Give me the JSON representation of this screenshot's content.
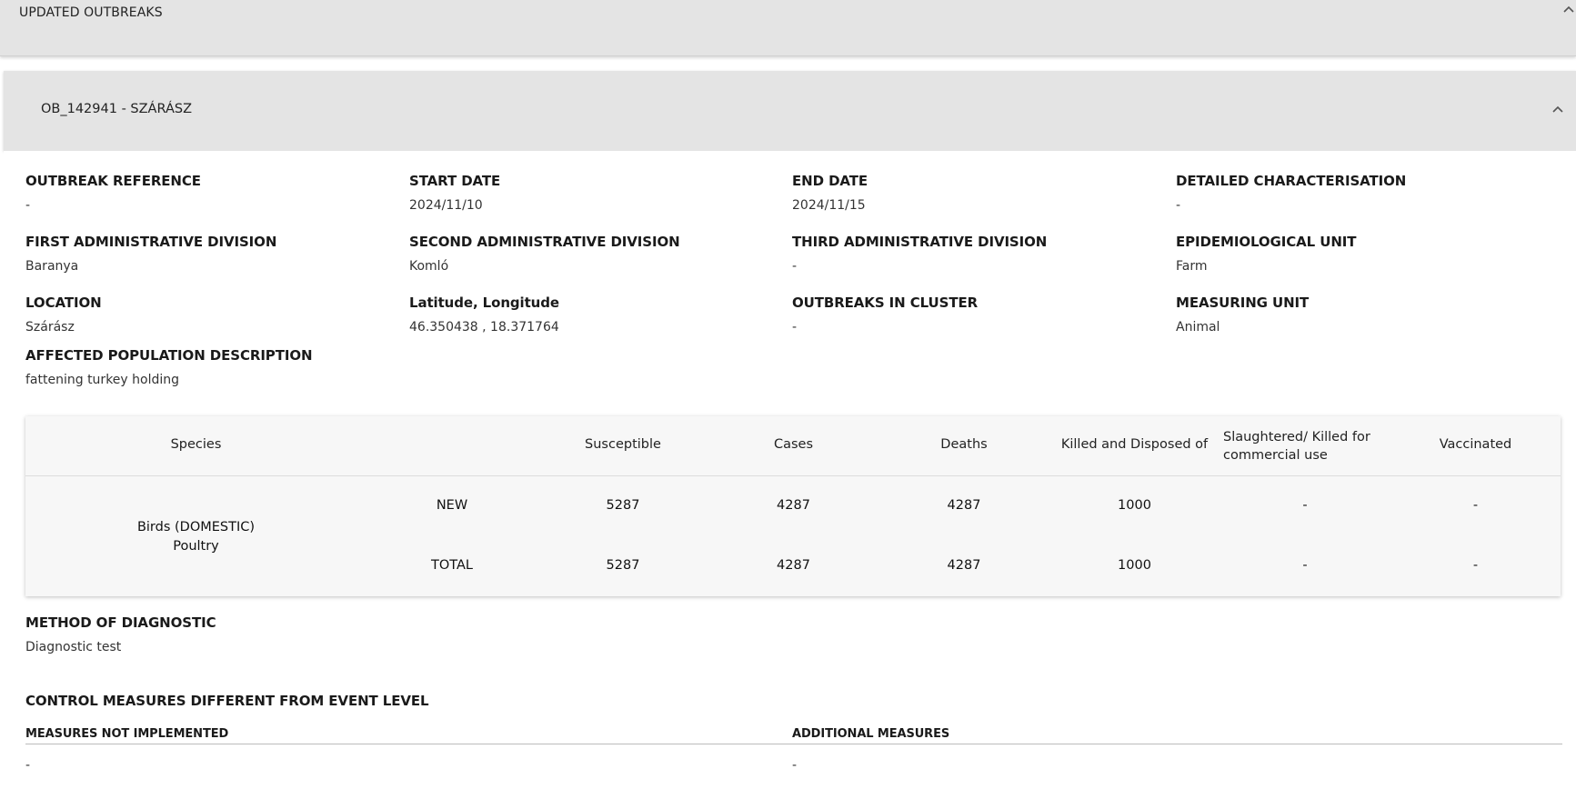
{
  "top_panel": {
    "title": "UPDATED OUTBREAKS"
  },
  "outbreak": {
    "header_title": "OB_142941 - SZÁRÁSZ",
    "fields": {
      "outbreak_reference": {
        "label": "OUTBREAK REFERENCE",
        "value": "-"
      },
      "start_date": {
        "label": "START DATE",
        "value": "2024/11/10"
      },
      "end_date": {
        "label": "END DATE",
        "value": "2024/11/15"
      },
      "detailed_characterisation": {
        "label": "DETAILED CHARACTERISATION",
        "value": "-"
      },
      "first_admin": {
        "label": "FIRST ADMINISTRATIVE DIVISION",
        "value": "Baranya"
      },
      "second_admin": {
        "label": "SECOND ADMINISTRATIVE DIVISION",
        "value": "Komló"
      },
      "third_admin": {
        "label": "THIRD ADMINISTRATIVE DIVISION",
        "value": "-"
      },
      "epi_unit": {
        "label": "EPIDEMIOLOGICAL UNIT",
        "value": "Farm"
      },
      "location": {
        "label": "LOCATION",
        "value": "Szárász"
      },
      "lat_long": {
        "label": "Latitude, Longitude",
        "value": "46.350438 , 18.371764"
      },
      "outbreaks_in_cluster": {
        "label": "OUTBREAKS IN CLUSTER",
        "value": "-"
      },
      "measuring_unit": {
        "label": "MEASURING UNIT",
        "value": "Animal"
      },
      "affected_population": {
        "label": "AFFECTED POPULATION DESCRIPTION",
        "value": "fattening turkey holding"
      },
      "method_of_diagnostic": {
        "label": "METHOD OF DIAGNOSTIC",
        "value": "Diagnostic test"
      }
    },
    "table": {
      "headers": {
        "species": "Species",
        "susceptible": "Susceptible",
        "cases": "Cases",
        "deaths": "Deaths",
        "killed": "Killed and Disposed of",
        "slaughtered": "Slaughtered/ Killed for commercial use",
        "vaccinated": "Vaccinated"
      },
      "species_line1": "Birds (DOMESTIC)",
      "species_line2": "Poultry",
      "rows": [
        {
          "label": "NEW",
          "susceptible": "5287",
          "cases": "4287",
          "deaths": "4287",
          "killed": "1000",
          "slaughtered": "-",
          "vaccinated": "-"
        },
        {
          "label": "TOTAL",
          "susceptible": "5287",
          "cases": "4287",
          "deaths": "4287",
          "killed": "1000",
          "slaughtered": "-",
          "vaccinated": "-"
        }
      ]
    },
    "control_measures": {
      "title": "CONTROL MEASURES DIFFERENT FROM EVENT LEVEL",
      "not_implemented_label": "MEASURES NOT IMPLEMENTED",
      "not_implemented_value": "-",
      "additional_label": "ADDITIONAL MEASURES",
      "additional_value": "-"
    }
  }
}
